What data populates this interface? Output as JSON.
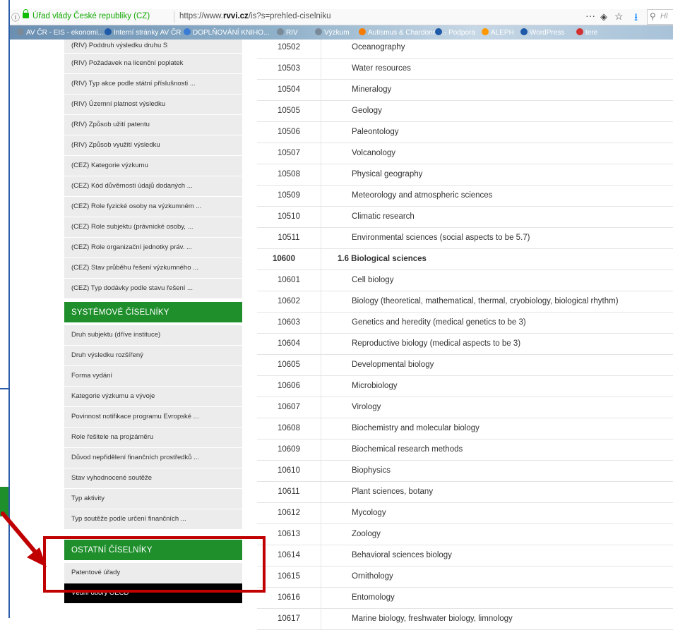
{
  "browser": {
    "site_identity": "Úřad vlády České republiky (CZ)",
    "url_prefix": "https://www.",
    "url_domain": "rvvi.cz",
    "url_suffix": "/is?s=prehled-ciselniku",
    "more_icon": "···",
    "search_placeholder": "Hl"
  },
  "bookmarks": [
    {
      "label": "AV ČR - EIS - ekonomi...",
      "color": "#7a8a99"
    },
    {
      "label": "Interní stránky AV ČR",
      "color": "#1e5aa8"
    },
    {
      "label": "DOPLŇOVÁNÍ KNIHO...",
      "color": "#3a7bd5"
    },
    {
      "label": "RIV",
      "color": "#7a8a99"
    },
    {
      "label": "Výzkum",
      "color": "#7a8a99"
    },
    {
      "label": "Autismus & Chardonna...",
      "color": "#f57c00"
    },
    {
      "label": "- Podpora",
      "color": "#1e5aa8"
    },
    {
      "label": "ALEPH",
      "color": "#ff9800"
    },
    {
      "label": "WordPress",
      "color": "#1e5aa8"
    },
    {
      "label": "tere",
      "color": "#d32f2f"
    }
  ],
  "sidebar": {
    "riv_items": [
      "(RIV) Poddruh výsledku druhu S",
      "(RIV) Požadavek na licenční poplatek",
      "(RIV) Typ akce podle státní příslušnosti ...",
      "(RIV) Územní platnost výsledku",
      "(RIV) Způsob užití patentu",
      "(RIV) Způsob využití výsledku",
      "(CEZ) Kategorie výzkumu",
      "(CEZ) Kód důvěrnosti údajů dodaných ...",
      "(CEZ) Role fyzické osoby na výzkumném ...",
      "(CEZ) Role subjektu (právnické osoby, ...",
      "(CEZ) Role organizační jednotky práv. ...",
      "(CEZ) Stav průběhu řešení výzkumného ...",
      "(CEZ) Typ dodávky podle stavu řešení ..."
    ],
    "system_heading": "SYSTÉMOVÉ ČÍSELNÍKY",
    "system_items": [
      "Druh subjektu (dříve instituce)",
      "Druh výsledku rozšířený",
      "Forma vydání",
      "Kategorie výzkumu a vývoje",
      "Povinnost notifikace programu Evropské ...",
      "Role řešitele na projzáměru",
      "Důvod nepřidělení finančních prostředků ...",
      "Stav vyhodnocené soutěže",
      "Typ aktivity",
      "Typ soutěže podle určení finančních ..."
    ],
    "other_heading": "OSTATNÍ ČÍSELNÍKY",
    "other_items": [
      "Patentové úřady",
      "Vědní obory OECD"
    ]
  },
  "table": {
    "rows": [
      {
        "code": "10502",
        "name": "Oceanography",
        "group": false
      },
      {
        "code": "10503",
        "name": "Water resources",
        "group": false
      },
      {
        "code": "10504",
        "name": "Mineralogy",
        "group": false
      },
      {
        "code": "10505",
        "name": "Geology",
        "group": false
      },
      {
        "code": "10506",
        "name": "Paleontology",
        "group": false
      },
      {
        "code": "10507",
        "name": "Volcanology",
        "group": false
      },
      {
        "code": "10508",
        "name": "Physical geography",
        "group": false
      },
      {
        "code": "10509",
        "name": "Meteorology and atmospheric sciences",
        "group": false
      },
      {
        "code": "10510",
        "name": "Climatic research",
        "group": false
      },
      {
        "code": "10511",
        "name": "Environmental sciences (social aspects to be 5.7)",
        "group": false
      },
      {
        "code": "10600",
        "name": "1.6 Biological sciences",
        "group": true
      },
      {
        "code": "10601",
        "name": "Cell biology",
        "group": false
      },
      {
        "code": "10602",
        "name": "Biology (theoretical, mathematical, thermal, cryobiology, biological rhythm)",
        "group": false
      },
      {
        "code": "10603",
        "name": "Genetics and heredity (medical genetics to be 3)",
        "group": false
      },
      {
        "code": "10604",
        "name": "Reproductive biology (medical aspects to be 3)",
        "group": false
      },
      {
        "code": "10605",
        "name": "Developmental biology",
        "group": false
      },
      {
        "code": "10606",
        "name": "Microbiology",
        "group": false
      },
      {
        "code": "10607",
        "name": "Virology",
        "group": false
      },
      {
        "code": "10608",
        "name": "Biochemistry and molecular biology",
        "group": false
      },
      {
        "code": "10609",
        "name": "Biochemical research methods",
        "group": false
      },
      {
        "code": "10610",
        "name": "Biophysics",
        "group": false
      },
      {
        "code": "10611",
        "name": "Plant sciences, botany",
        "group": false
      },
      {
        "code": "10612",
        "name": "Mycology",
        "group": false
      },
      {
        "code": "10613",
        "name": "Zoology",
        "group": false
      },
      {
        "code": "10614",
        "name": "Behavioral sciences biology",
        "group": false
      },
      {
        "code": "10615",
        "name": "Ornithology",
        "group": false
      },
      {
        "code": "10616",
        "name": "Entomology",
        "group": false
      },
      {
        "code": "10617",
        "name": "Marine biology, freshwater biology, limnology",
        "group": false
      }
    ]
  },
  "colors": {
    "green_heading": "#1f8f2c",
    "annotation_red": "#c00000",
    "active_item": "#000000"
  }
}
